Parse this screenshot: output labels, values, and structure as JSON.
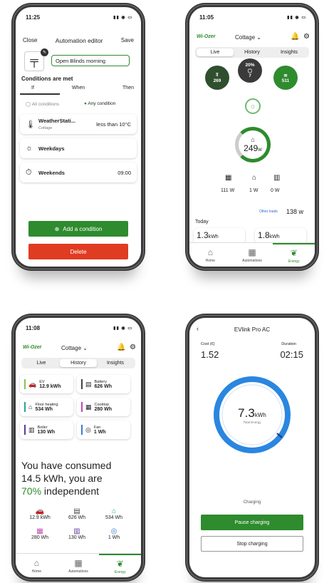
{
  "p1": {
    "time": "11:25",
    "close": "Close",
    "title": "Automation editor",
    "save": "Save",
    "name": "Open Blinds morning",
    "section": "Conditions are met",
    "tabs": [
      "If",
      "When",
      "Then"
    ],
    "all": "All conditions",
    "any": "Any condition",
    "c1_title": "WeatherStati...",
    "c1_sub": "Cottage",
    "c1_val": "less than 10°C",
    "c2": "Weekdays",
    "c3": "Weekends",
    "c3_val": "09:00",
    "add": "Add a condition",
    "del": "Delete"
  },
  "p2": {
    "time": "11:05",
    "brand": "Wi-Ozer",
    "site": "Cottage",
    "tabs": [
      "Live",
      "History",
      "Insights"
    ],
    "b1": "269",
    "b2_top": "20%",
    "b2": "7",
    "b3": "511",
    "center": "249",
    "unit": "W",
    "l1": "111 W",
    "l2": "1 W",
    "l3": "0 W",
    "other": "Other loads",
    "other_val": "138 w",
    "today": "Today",
    "t1": "1.3",
    "t2": "1.8",
    "kwh": "kWh",
    "nav": [
      "Home",
      "Automations",
      "Energy"
    ]
  },
  "p3": {
    "time": "11:08",
    "brand": "Wi-Ozer",
    "site": "Cottage",
    "tabs": [
      "Live",
      "History",
      "Insights"
    ],
    "cards": [
      {
        "n": "EV",
        "v": "12.9 kWh",
        "c": "#8bc34a"
      },
      {
        "n": "Battery",
        "v": "626 Wh",
        "c": "#444"
      },
      {
        "n": "Floor heating",
        "v": "534 Wh",
        "c": "#26a69a"
      },
      {
        "n": "Cooktop",
        "v": "280 Wh",
        "c": "#c04ab0"
      },
      {
        "n": "Boiler",
        "v": "130 Wh",
        "c": "#5c3a9a"
      },
      {
        "n": "Fan",
        "v": "1 Wh",
        "c": "#3a7bd5"
      }
    ],
    "l1": "You have consumed",
    "l2": "14.5 kWh, you are",
    "pct": "70%",
    "l3": " independent",
    "s": [
      "12.9 kWh",
      "626 Wh",
      "534 Wh",
      "280 Wh",
      "130 Wh",
      "1 Wh"
    ],
    "nav": [
      "Home",
      "Automations",
      "Energy"
    ]
  },
  "p4": {
    "title": "EVlink Pro AC",
    "cost_l": "Cost (€)",
    "cost": "1.52",
    "dur_l": "Duration",
    "dur": "02:15",
    "val": "7.3",
    "unit": "kWh",
    "sub": "Total Energy",
    "status": "Charging",
    "pause": "Pause charging",
    "stop": "Stop charging"
  },
  "colors": {
    "green": "#2e8b2e",
    "red": "#e03c22",
    "blue": "#2a86e0"
  }
}
